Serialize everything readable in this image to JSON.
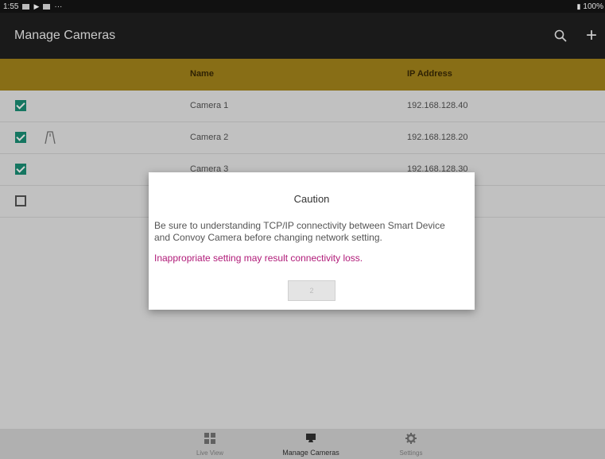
{
  "status_bar": {
    "time": "1:55",
    "dots": "···",
    "battery": "100%"
  },
  "app_bar": {
    "title": "Manage Cameras"
  },
  "table": {
    "columns": [
      "Name",
      "IP Address"
    ],
    "rows": [
      {
        "name": "Camera 1",
        "ip": "192.168.128.40",
        "checked": true
      },
      {
        "name": "Camera 2",
        "ip": "192.168.128.20",
        "checked": true
      },
      {
        "name": "Camera 3",
        "ip": "192.168.128.30",
        "checked": true
      },
      {
        "name": "",
        "ip": "",
        "checked": false
      }
    ]
  },
  "dialog": {
    "title": "Caution",
    "message": "Be sure to understanding TCP/IP connectivity between Smart Device and Convoy Camera before changing network setting.",
    "warning": "Inappropriate setting may result connectivity loss.",
    "button": "2"
  },
  "bottom_nav": {
    "items": [
      {
        "label": "Live View",
        "icon": "grid-icon"
      },
      {
        "label": "Manage Cameras",
        "icon": "camera-icon"
      },
      {
        "label": "Settings",
        "icon": "gear-icon"
      }
    ]
  },
  "colors": {
    "header_bg": "#a7871c",
    "checkbox": "#1a9177",
    "warning_text": "#b01a78",
    "app_bar": "#1a1a1a"
  }
}
